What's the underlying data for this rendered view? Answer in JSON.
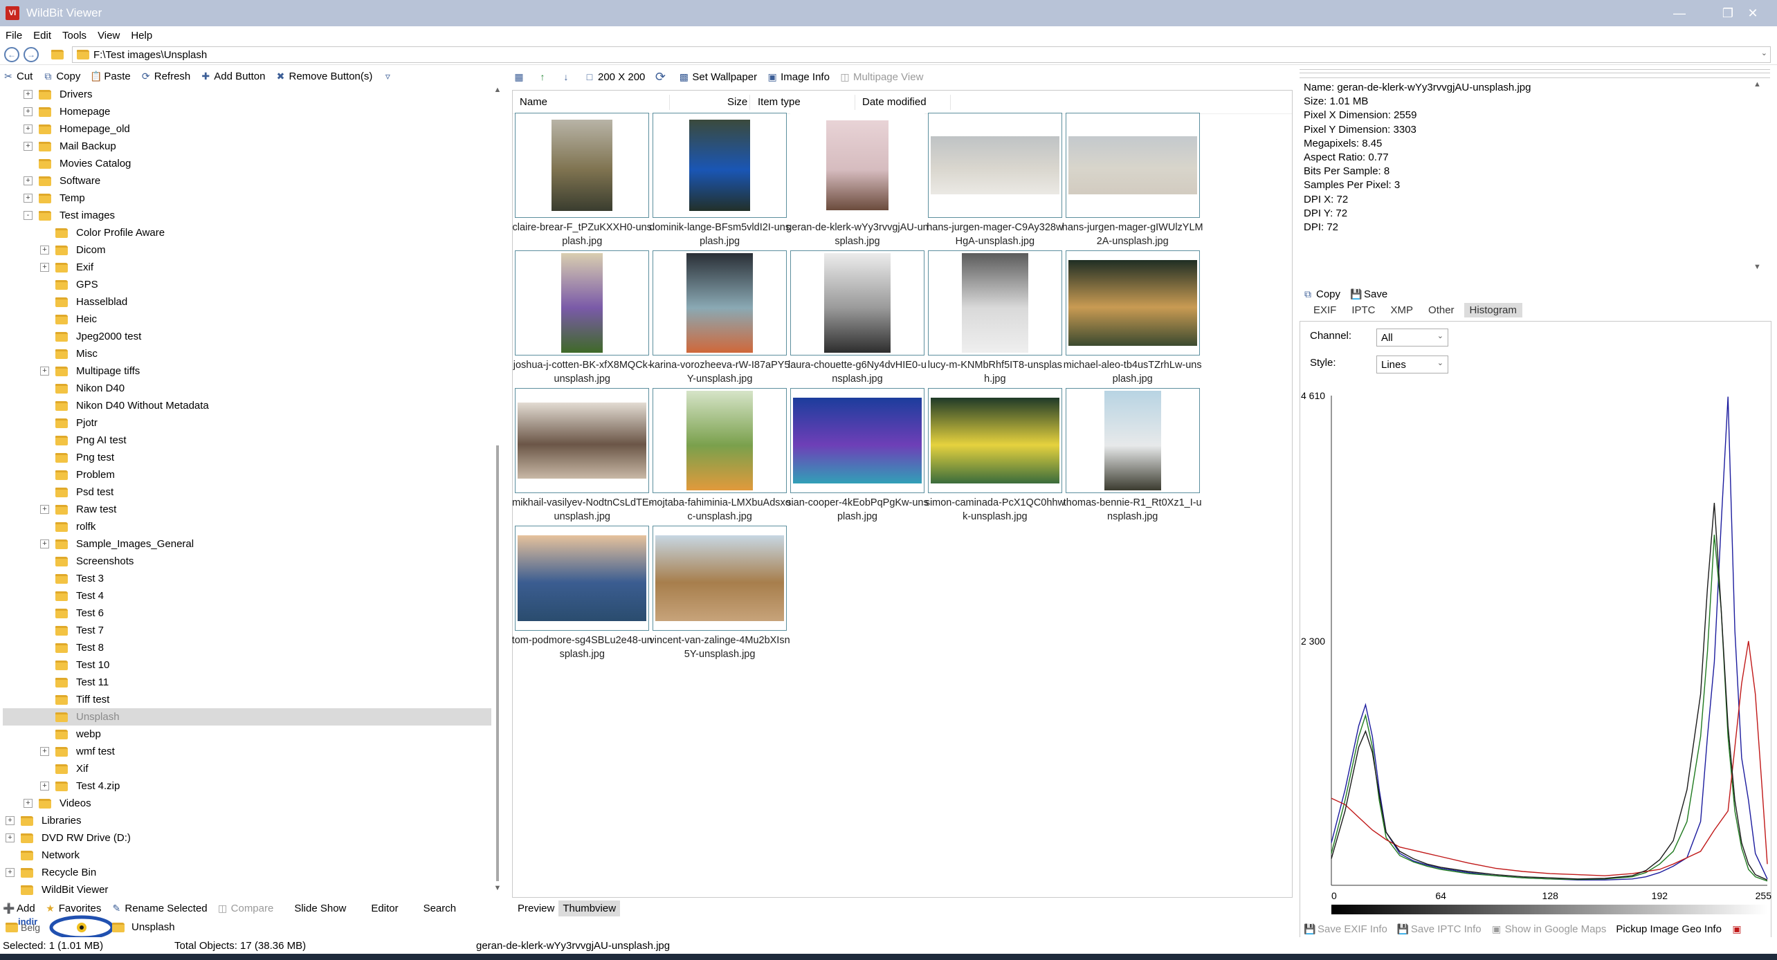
{
  "window": {
    "title": "WildBit Viewer",
    "icon_text": "VI"
  },
  "menu": [
    "File",
    "Edit",
    "Tools",
    "View",
    "Help"
  ],
  "address": {
    "path": "F:\\Test images\\Unsplash"
  },
  "left_toolbar": {
    "cut": "Cut",
    "copy": "Copy",
    "paste": "Paste",
    "refresh": "Refresh",
    "add_button": "Add Button",
    "remove_buttons": "Remove Button(s)"
  },
  "tree": [
    {
      "label": "Drivers",
      "level": 1,
      "exp": "+"
    },
    {
      "label": "Homepage",
      "level": 1,
      "exp": "+"
    },
    {
      "label": "Homepage_old",
      "level": 1,
      "exp": "+"
    },
    {
      "label": "Mail Backup",
      "level": 1,
      "exp": "+"
    },
    {
      "label": "Movies Catalog",
      "level": 1,
      "exp": ""
    },
    {
      "label": "Software",
      "level": 1,
      "exp": "+"
    },
    {
      "label": "Temp",
      "level": 1,
      "exp": "+"
    },
    {
      "label": "Test images",
      "level": 1,
      "exp": "-"
    },
    {
      "label": "Color Profile Aware",
      "level": 2,
      "exp": ""
    },
    {
      "label": "Dicom",
      "level": 2,
      "exp": "+"
    },
    {
      "label": "Exif",
      "level": 2,
      "exp": "+"
    },
    {
      "label": "GPS",
      "level": 2,
      "exp": ""
    },
    {
      "label": "Hasselblad",
      "level": 2,
      "exp": ""
    },
    {
      "label": "Heic",
      "level": 2,
      "exp": ""
    },
    {
      "label": "Jpeg2000 test",
      "level": 2,
      "exp": ""
    },
    {
      "label": "Misc",
      "level": 2,
      "exp": ""
    },
    {
      "label": "Multipage tiffs",
      "level": 2,
      "exp": "+"
    },
    {
      "label": "Nikon D40",
      "level": 2,
      "exp": ""
    },
    {
      "label": "Nikon D40 Without Metadata",
      "level": 2,
      "exp": ""
    },
    {
      "label": "Pjotr",
      "level": 2,
      "exp": ""
    },
    {
      "label": "Png AI test",
      "level": 2,
      "exp": ""
    },
    {
      "label": "Png test",
      "level": 2,
      "exp": ""
    },
    {
      "label": "Problem",
      "level": 2,
      "exp": ""
    },
    {
      "label": "Psd test",
      "level": 2,
      "exp": ""
    },
    {
      "label": "Raw test",
      "level": 2,
      "exp": "+"
    },
    {
      "label": "rolfk",
      "level": 2,
      "exp": ""
    },
    {
      "label": "Sample_Images_General",
      "level": 2,
      "exp": "+"
    },
    {
      "label": "Screenshots",
      "level": 2,
      "exp": ""
    },
    {
      "label": "Test 3",
      "level": 2,
      "exp": ""
    },
    {
      "label": "Test 4",
      "level": 2,
      "exp": ""
    },
    {
      "label": "Test 6",
      "level": 2,
      "exp": ""
    },
    {
      "label": "Test 7",
      "level": 2,
      "exp": ""
    },
    {
      "label": "Test 8",
      "level": 2,
      "exp": ""
    },
    {
      "label": "Test 10",
      "level": 2,
      "exp": ""
    },
    {
      "label": "Test 11",
      "level": 2,
      "exp": ""
    },
    {
      "label": "Tiff test",
      "level": 2,
      "exp": ""
    },
    {
      "label": "Unsplash",
      "level": 2,
      "exp": "",
      "selected": true
    },
    {
      "label": "webp",
      "level": 2,
      "exp": ""
    },
    {
      "label": "wmf test",
      "level": 2,
      "exp": "+"
    },
    {
      "label": "Xif",
      "level": 2,
      "exp": ""
    },
    {
      "label": "Test 4.zip",
      "level": 2,
      "exp": "+"
    },
    {
      "label": "Videos",
      "level": 1,
      "exp": "+"
    },
    {
      "label": "Libraries",
      "level": 0,
      "exp": "+"
    },
    {
      "label": "DVD RW Drive (D:)",
      "level": 0,
      "exp": "+"
    },
    {
      "label": "Network",
      "level": 0,
      "exp": ""
    },
    {
      "label": "Recycle Bin",
      "level": 0,
      "exp": "+"
    },
    {
      "label": "WildBit Viewer",
      "level": 0,
      "exp": ""
    }
  ],
  "left_bottom_toolbar": {
    "add": "Add",
    "favorites": "Favorites",
    "rename": "Rename Selected",
    "compare": "Compare",
    "slideshow": "Slide Show",
    "editor": "Editor",
    "search": "Search"
  },
  "drivebar": {
    "item1": "Belg",
    "item2": "Unsplash",
    "watermark": "indir"
  },
  "mid_toolbar": {
    "size": "200 X 200",
    "set_wallpaper": "Set Wallpaper",
    "image_info": "Image Info",
    "multipage_view": "Multipage View"
  },
  "columns": [
    "Name",
    "Size",
    "Item type",
    "Date modified"
  ],
  "thumbs": [
    {
      "caption": "claire-brear-F_tPZuKXXH0-unsplash.jpg",
      "w": 88,
      "h": 132,
      "colors": [
        "#b8b4a7",
        "#7f7350",
        "#3a3d2f"
      ]
    },
    {
      "caption": "dominik-lange-BFsm5vldI2I-unsplash.jpg",
      "w": 88,
      "h": 132,
      "colors": [
        "#3b4a3c",
        "#1a56b5",
        "#223029"
      ]
    },
    {
      "caption": "geran-de-klerk-wYy3rvvgjAU-unsplash.jpg",
      "w": 90,
      "h": 130,
      "colors": [
        "#e8d3d6",
        "#d6bcbf",
        "#6b4b3c"
      ],
      "selected": true
    },
    {
      "caption": "hans-jurgen-mager-C9Ay328wHgA-unsplash.jpg",
      "w": 186,
      "h": 84,
      "colors": [
        "#bfc3c5",
        "#d9d6ce",
        "#ebe9e4"
      ]
    },
    {
      "caption": "hans-jurgen-mager-gIWUlzYLM2A-unsplash.jpg",
      "w": 186,
      "h": 84,
      "colors": [
        "#c4c9cd",
        "#d8d5cb",
        "#d2cbc0"
      ]
    },
    {
      "caption": "joshua-j-cotten-BK-xfX8MQCk-unsplash.jpg",
      "w": 60,
      "h": 144,
      "colors": [
        "#d9ceb0",
        "#7a5aa8",
        "#3f6a28"
      ]
    },
    {
      "caption": "karina-vorozheeva-rW-I87aPY5Y-unsplash.jpg",
      "w": 96,
      "h": 144,
      "colors": [
        "#2a2f36",
        "#8aa9b4",
        "#d0683a"
      ]
    },
    {
      "caption": "laura-chouette-g6Ny4dvHIE0-unsplash.jpg",
      "w": 96,
      "h": 144,
      "colors": [
        "#ececec",
        "#9a9a9a",
        "#2e2e2e"
      ]
    },
    {
      "caption": "lucy-m-KNMbRhf5IT8-unsplash.jpg",
      "w": 96,
      "h": 144,
      "colors": [
        "#5b5b5b",
        "#d9d9d9",
        "#efefef"
      ]
    },
    {
      "caption": "michael-aleo-tb4usTZrhLw-unsplash.jpg",
      "w": 186,
      "h": 124,
      "colors": [
        "#1f2e24",
        "#c99b53",
        "#3b4a2f"
      ]
    },
    {
      "caption": "mikhail-vasilyev-NodtnCsLdTE-unsplash.jpg",
      "w": 186,
      "h": 110,
      "colors": [
        "#e3dcd3",
        "#6b5647",
        "#c8b8a6"
      ]
    },
    {
      "caption": "mojtaba-fahiminia-LMXbuAdsxoc-unsplash.jpg",
      "w": 96,
      "h": 144,
      "colors": [
        "#d6e4c8",
        "#7aa04c",
        "#e19a3c"
      ]
    },
    {
      "caption": "sian-cooper-4kEobPqPgKw-unsplash.jpg",
      "w": 186,
      "h": 124,
      "colors": [
        "#1c3d9c",
        "#6e3fb7",
        "#32a0b7"
      ]
    },
    {
      "caption": "simon-caminada-PcX1QC0hhwk-unsplash.jpg",
      "w": 186,
      "h": 124,
      "colors": [
        "#1f3a28",
        "#e6d23e",
        "#3a6c3c"
      ]
    },
    {
      "caption": "thomas-bennie-R1_Rt0Xz1_I-unsplash.jpg",
      "w": 82,
      "h": 144,
      "colors": [
        "#b8d4e3",
        "#e7e9ea",
        "#3b3b2f"
      ]
    },
    {
      "caption": "tom-podmore-sg4SBLu2e48-unsplash.jpg",
      "w": 186,
      "h": 124,
      "colors": [
        "#e6c29c",
        "#3b5d91",
        "#2a4c6e"
      ]
    },
    {
      "caption": "vincent-van-zalinge-4Mu2bXIsn5Y-unsplash.jpg",
      "w": 186,
      "h": 124,
      "colors": [
        "#c7d7e3",
        "#a77e4c",
        "#c7a37a"
      ]
    }
  ],
  "view_tabs": {
    "preview": "Preview",
    "thumbview": "Thumbview"
  },
  "info": {
    "lines": [
      "Name: geran-de-klerk-wYy3rvvgjAU-unsplash.jpg",
      "Size: 1.01 MB",
      "Pixel X Dimension: 2559",
      "Pixel Y Dimension: 3303",
      "Megapixels: 8.45",
      "Aspect Ratio: 0.77",
      "Bits Per Sample: 8",
      "Samples Per Pixel: 3",
      "DPI X: 72",
      "DPI Y: 72",
      "DPI: 72"
    ]
  },
  "right_toolbar": {
    "copy": "Copy",
    "save": "Save"
  },
  "tabs": [
    "EXIF",
    "IPTC",
    "XMP",
    "Other",
    "Histogram"
  ],
  "histogram_controls": {
    "channel_label": "Channel:",
    "channel_value": "All",
    "style_label": "Style:",
    "style_value": "Lines"
  },
  "chart_data": {
    "type": "line",
    "title": "",
    "xlabel": "",
    "ylabel": "",
    "xlim": [
      0,
      255
    ],
    "ylim": [
      0,
      4610
    ],
    "x_ticks": [
      "0",
      "64",
      "128",
      "192",
      "255"
    ],
    "y_ticks": [
      "4 610",
      "2 300"
    ],
    "series": [
      {
        "color": "#1c1c9e",
        "x": [
          0,
          8,
          16,
          20,
          24,
          28,
          32,
          40,
          48,
          56,
          64,
          80,
          96,
          112,
          128,
          144,
          160,
          176,
          184,
          192,
          200,
          208,
          216,
          220,
          224,
          228,
          232,
          236,
          240,
          244,
          248,
          255
        ],
        "values": [
          400,
          900,
          1500,
          1700,
          1400,
          900,
          500,
          300,
          230,
          190,
          160,
          120,
          90,
          70,
          60,
          50,
          50,
          60,
          80,
          120,
          180,
          260,
          600,
          1400,
          2100,
          3400,
          4600,
          2400,
          1200,
          800,
          300,
          60
        ]
      },
      {
        "color": "#1f7a1f",
        "x": [
          0,
          8,
          16,
          20,
          24,
          28,
          32,
          40,
          48,
          56,
          64,
          80,
          96,
          112,
          128,
          144,
          160,
          176,
          184,
          192,
          200,
          208,
          216,
          220,
          224,
          228,
          232,
          236,
          240,
          244,
          248,
          255
        ],
        "values": [
          300,
          800,
          1400,
          1600,
          1300,
          800,
          450,
          280,
          220,
          180,
          150,
          110,
          90,
          70,
          60,
          55,
          60,
          80,
          120,
          200,
          320,
          600,
          1400,
          2200,
          3300,
          2600,
          1400,
          700,
          350,
          150,
          80,
          40
        ]
      },
      {
        "color": "#c01818",
        "x": [
          0,
          8,
          16,
          24,
          32,
          40,
          48,
          56,
          64,
          80,
          96,
          112,
          128,
          144,
          160,
          176,
          192,
          200,
          208,
          216,
          224,
          232,
          236,
          240,
          244,
          248,
          252,
          255
        ],
        "values": [
          820,
          760,
          640,
          520,
          430,
          360,
          330,
          300,
          270,
          210,
          160,
          130,
          110,
          100,
          90,
          110,
          150,
          200,
          260,
          320,
          520,
          700,
          1300,
          1900,
          2300,
          1800,
          900,
          200
        ]
      },
      {
        "color": "#1a1a1a",
        "x": [
          0,
          8,
          16,
          20,
          24,
          28,
          32,
          40,
          48,
          56,
          64,
          80,
          96,
          112,
          128,
          144,
          160,
          176,
          184,
          192,
          200,
          208,
          216,
          220,
          224,
          228,
          232,
          236,
          240,
          244,
          248,
          255
        ],
        "values": [
          250,
          700,
          1300,
          1450,
          1250,
          850,
          500,
          320,
          250,
          200,
          170,
          130,
          100,
          80,
          70,
          60,
          65,
          90,
          140,
          240,
          420,
          900,
          1800,
          2800,
          3600,
          2600,
          1500,
          800,
          400,
          200,
          100,
          50
        ]
      }
    ]
  },
  "right_bottom_toolbar": {
    "save_exif": "Save EXIF Info",
    "save_iptc": "Save IPTC Info",
    "show_maps": "Show in Google Maps",
    "pickup_geo": "Pickup Image Geo Info"
  },
  "status": {
    "selected": "Selected: 1 (1.01 MB)",
    "total": "Total Objects: 17 (38.36 MB)",
    "filename": "geran-de-klerk-wYy3rvvgjAU-unsplash.jpg"
  }
}
